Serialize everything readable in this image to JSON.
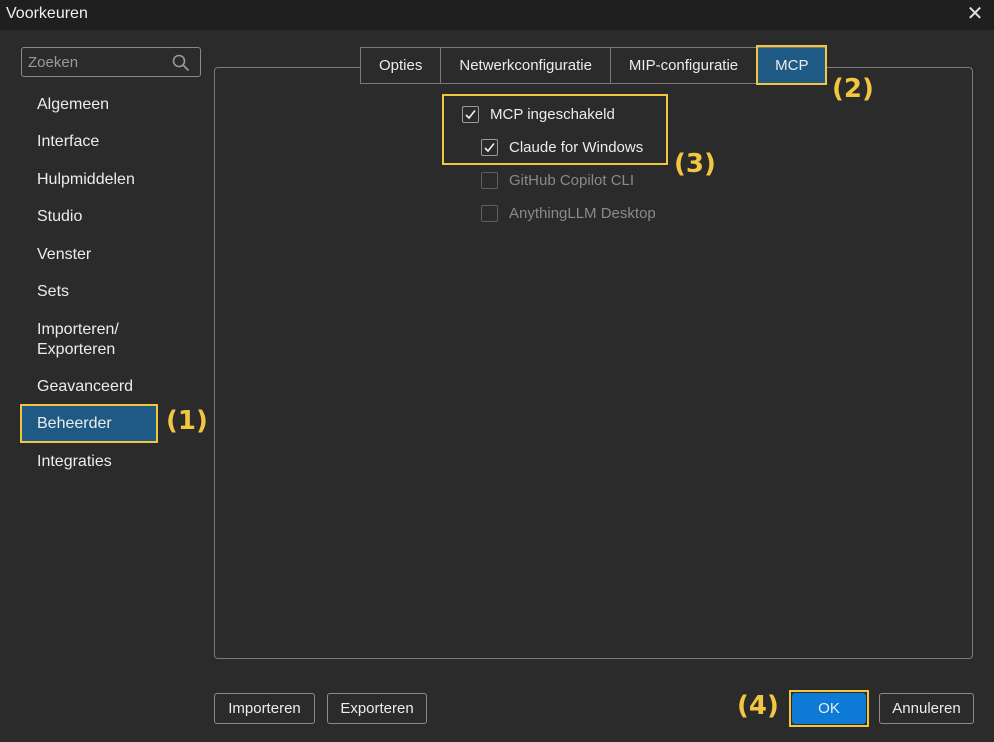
{
  "window": {
    "title": "Voorkeuren",
    "close_icon": "close-icon"
  },
  "search": {
    "placeholder": "Zoeken",
    "value": "",
    "icon": "search-icon"
  },
  "sidebar": {
    "items": [
      {
        "label": "Algemeen",
        "active": false
      },
      {
        "label": "Interface",
        "active": false
      },
      {
        "label": "Hulpmiddelen",
        "active": false
      },
      {
        "label": "Studio",
        "active": false
      },
      {
        "label": "Venster",
        "active": false
      },
      {
        "label": "Sets",
        "active": false
      },
      {
        "label": "Importeren/\nExporteren",
        "active": false
      },
      {
        "label": "Geavanceerd",
        "active": false
      },
      {
        "label": "Beheerder",
        "active": true
      },
      {
        "label": "Integraties",
        "active": false
      }
    ]
  },
  "tabs": [
    {
      "label": "Opties",
      "active": false
    },
    {
      "label": "Netwerkconfiguratie",
      "active": false
    },
    {
      "label": "MIP-configuratie",
      "active": false
    },
    {
      "label": "MCP",
      "active": true
    }
  ],
  "mcp": {
    "options": [
      {
        "label": "MCP ingeschakeld",
        "checked": true,
        "enabled": true
      },
      {
        "label": "Claude for Windows",
        "checked": true,
        "enabled": true
      },
      {
        "label": "GitHub Copilot CLI",
        "checked": false,
        "enabled": false
      },
      {
        "label": "AnythingLLM Desktop",
        "checked": false,
        "enabled": false
      }
    ]
  },
  "callouts": [
    "(1)",
    "(2)",
    "(3)",
    "(4)"
  ],
  "footer": {
    "import_label": "Importeren",
    "export_label": "Exporteren",
    "ok_label": "OK",
    "cancel_label": "Annuleren"
  },
  "colors": {
    "background": "#2b2b2b",
    "accent": "#1f5a85",
    "primary_button": "#0d7ad6",
    "highlight": "#f3c63f"
  }
}
